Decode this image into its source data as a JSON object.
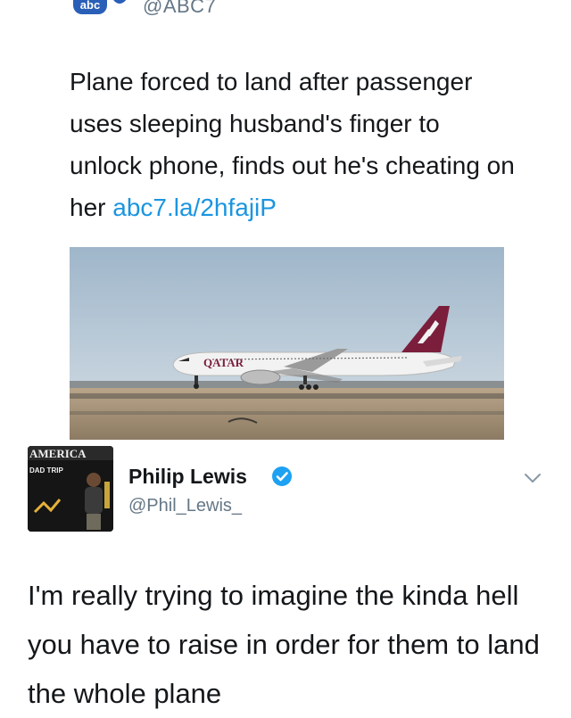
{
  "quoted_tweet": {
    "logo_text": "abc",
    "handle": "@ABC7",
    "text": "Plane forced to land after passenger uses sleeping husband's finger to unlock phone, finds out he's cheating on her ",
    "link": "abc7.la/2hfajiP",
    "image": {
      "airline_text": "QATAR"
    }
  },
  "reply_tweet": {
    "avatar": {
      "text_top": "AMERICA",
      "text_side": "DAD TRIP"
    },
    "author_name": "Philip Lewis",
    "author_handle": "@Phil_Lewis_",
    "verified": true,
    "text": "I'm really trying to imagine the kinda hell you have to raise in order for them to land the whole plane"
  },
  "colors": {
    "link": "#1b95e0",
    "verified_badge": "#1da1f2",
    "secondary_text": "#657786",
    "primary_text": "#14171a"
  },
  "icons": [
    "abc7-logo-icon",
    "verified-badge-icon",
    "chevron-down-icon"
  ]
}
